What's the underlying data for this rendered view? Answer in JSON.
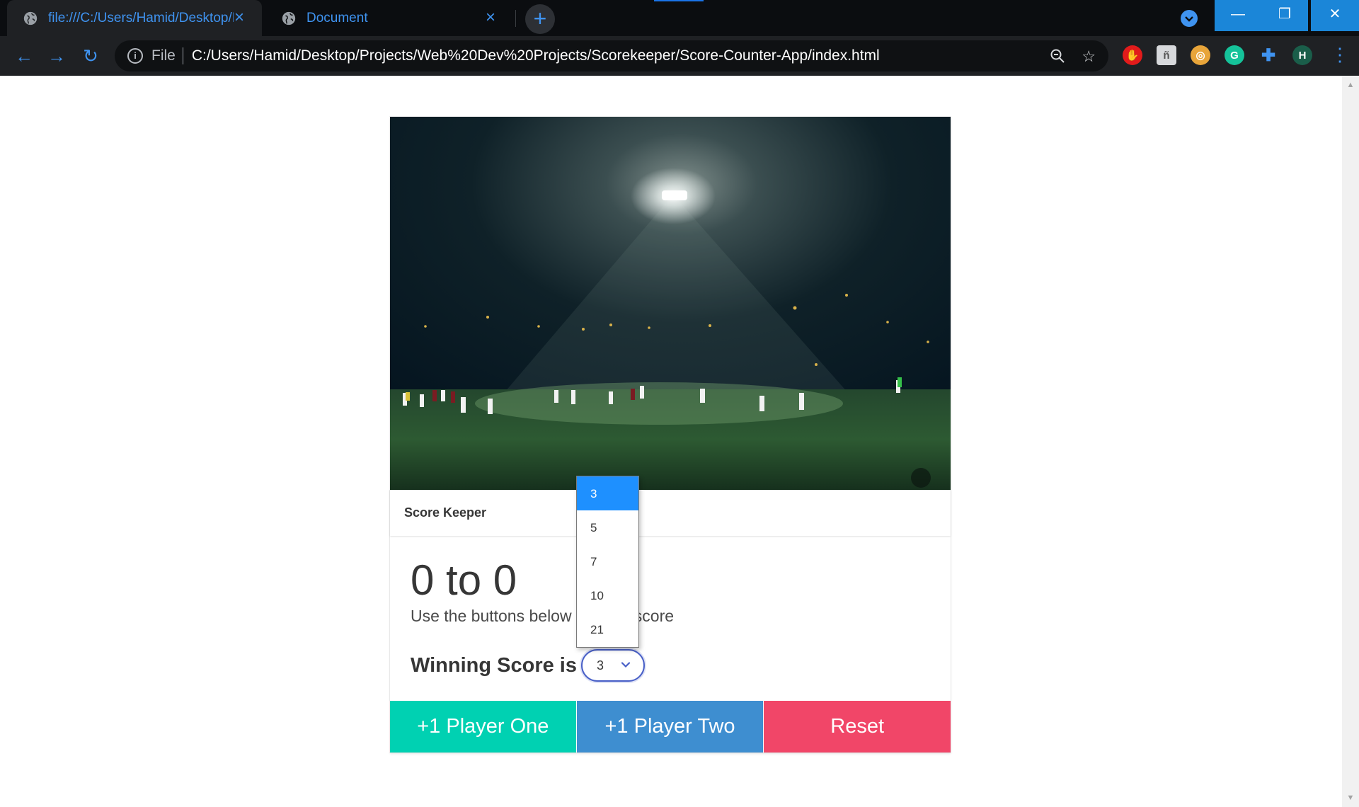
{
  "browser": {
    "tabs": [
      {
        "title": "file:///C:/Users/Hamid/Desktop/P",
        "active": true
      },
      {
        "title": "Document",
        "active": false
      }
    ],
    "new_tab_label": "+",
    "file_label": "File",
    "url": "C:/Users/Hamid/Desktop/Projects/Web%20Dev%20Projects/Scorekeeper/Score-Counter-App/index.html",
    "profile_initial": "H",
    "accent_color": "#3f93f0"
  },
  "card": {
    "header_title": "Score Keeper",
    "score_text": "0 to 0",
    "subtitle": "Use the buttons below to keep score",
    "winning_label": "Winning Score is",
    "winning_select": {
      "selected": "3",
      "options": [
        "3",
        "5",
        "7",
        "10",
        "21"
      ]
    },
    "buttons": {
      "player_one": "+1 Player One",
      "player_two": "+1 Player Two",
      "reset": "Reset"
    },
    "colors": {
      "player_one": "#00d1b2",
      "player_two": "#3e8ed0",
      "reset": "#f14668"
    }
  }
}
